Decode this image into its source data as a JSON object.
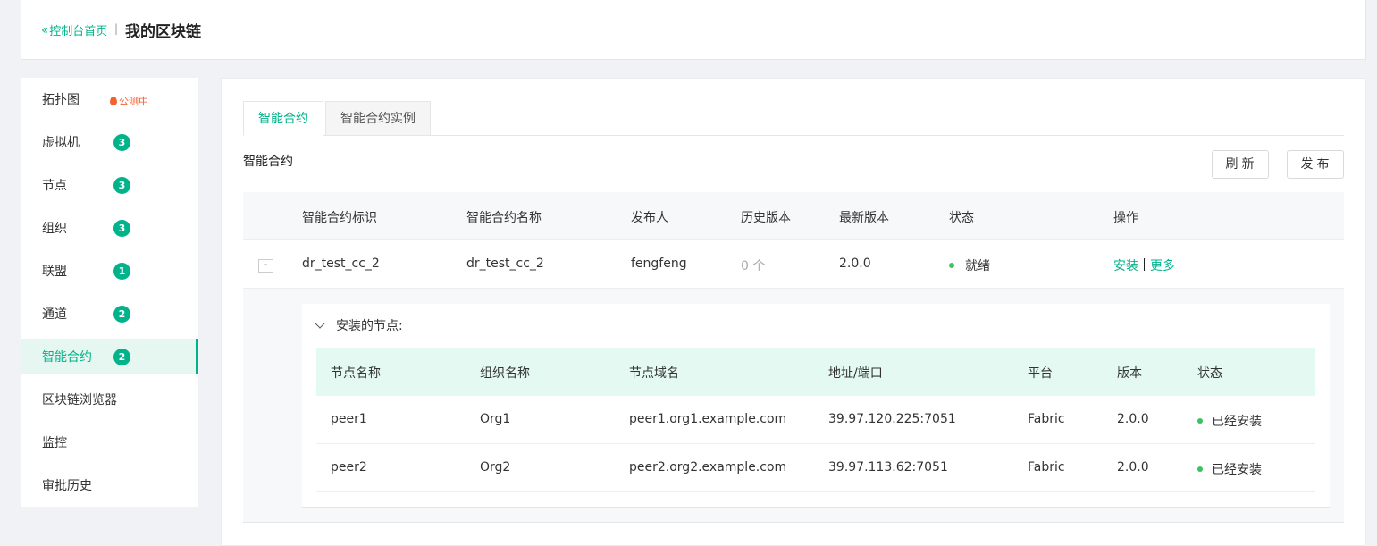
{
  "header": {
    "back_label": "控制台首页",
    "separator": "|",
    "title": "我的区块链"
  },
  "sidebar": {
    "items": [
      {
        "label": "拓扑图",
        "tag": "公测中"
      },
      {
        "label": "虚拟机",
        "count": "3"
      },
      {
        "label": "节点",
        "count": "3"
      },
      {
        "label": "组织",
        "count": "3"
      },
      {
        "label": "联盟",
        "count": "1"
      },
      {
        "label": "通道",
        "count": "2"
      },
      {
        "label": "智能合约",
        "count": "2",
        "active": true
      },
      {
        "label": "区块链浏览器"
      },
      {
        "label": "监控"
      },
      {
        "label": "审批历史"
      }
    ]
  },
  "tabs": [
    {
      "label": "智能合约",
      "active": true
    },
    {
      "label": "智能合约实例"
    }
  ],
  "section": {
    "title": "智能合约",
    "refresh_label": "刷新",
    "publish_label": "发布"
  },
  "table": {
    "columns": [
      "智能合约标识",
      "智能合约名称",
      "发布人",
      "历史版本",
      "最新版本",
      "状态",
      "操作"
    ],
    "rows": [
      {
        "expand_symbol": "-",
        "id": "dr_test_cc_2",
        "name": "dr_test_cc_2",
        "publisher": "fengfeng",
        "history": "0 个",
        "latest": "2.0.0",
        "status": "就绪",
        "actions": {
          "install": "安装",
          "more": "更多"
        }
      }
    ]
  },
  "nodes": {
    "title": "安装的节点:",
    "columns": [
      "节点名称",
      "组织名称",
      "节点域名",
      "地址/端口",
      "平台",
      "版本",
      "状态"
    ],
    "rows": [
      {
        "name": "peer1",
        "org": "Org1",
        "domain": "peer1.org1.example.com",
        "address": "39.97.120.225:7051",
        "platform": "Fabric",
        "version": "2.0.0",
        "status": "已经安装"
      },
      {
        "name": "peer2",
        "org": "Org2",
        "domain": "peer2.org2.example.com",
        "address": "39.97.113.62:7051",
        "platform": "Fabric",
        "version": "2.0.0",
        "status": "已经安装"
      }
    ]
  },
  "colors": {
    "accent": "#00b38a",
    "status_ok": "#3cc35f",
    "beta": "#f5602f"
  }
}
